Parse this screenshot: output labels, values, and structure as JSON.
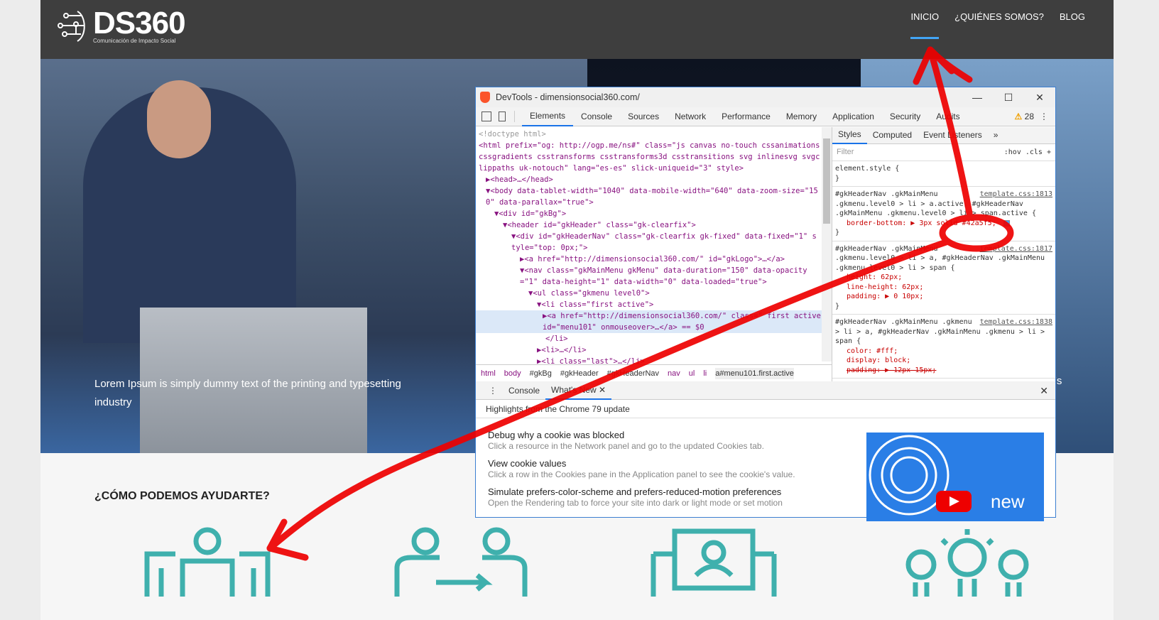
{
  "site": {
    "logo": {
      "title": "DS360",
      "subtitle": "Comunicación de Impacto Social"
    },
    "nav": [
      {
        "label": "INICIO",
        "active": true
      },
      {
        "label": "¿QUIÉNES SOMOS?"
      },
      {
        "label": "BLOG"
      }
    ],
    "accent": "#42a5f5",
    "hero_caption": "Lorem Ipsum is simply dummy text of the printing and typesetting industry",
    "hero_caption_right": "'s",
    "section_title": "¿CÓMO PODEMOS AYUDARTE?"
  },
  "devtools": {
    "title": "DevTools - dimensionsocial360.com/",
    "tabs": [
      "Elements",
      "Console",
      "Sources",
      "Network",
      "Performance",
      "Memory",
      "Application",
      "Security",
      "Audits"
    ],
    "warnings": "28",
    "elements": [
      "<!doctype html>",
      "<html prefix=\"og: http://ogp.me/ns#\" class=\"js canvas no-touch cssanimations cssgradients csstransforms csstransforms3d csstransitions svg inlinesvg svgclippaths uk-notouch\" lang=\"es-es\" slick-uniqueid=\"3\" style>",
      "▶<head>…</head>",
      "▼<body data-tablet-width=\"1040\" data-mobile-width=\"640\" data-zoom-size=\"150\" data-parallax=\"true\">",
      "▼<div id=\"gkBg\">",
      "▼<header id=\"gkHeader\" class=\"gk-clearfix\">",
      "▼<div id=\"gkHeaderNav\" class=\"gk-clearfix gk-fixed\" data-fixed=\"1\" style=\"top: 0px;\">",
      "▶<a href=\"http://dimensionsocial360.com/\" id=\"gkLogo\">…</a>",
      "▼<nav class=\"gkMainMenu gkMenu\" data-duration=\"150\" data-opacity=\"1\" data-height=\"1\" data-width=\"0\" data-loaded=\"true\">",
      "▼<ul class=\"gkmenu level0\">",
      "▼<li class=\"first active\">",
      "▶<a href=\"http://dimensionsocial360.com/\" class=\" first active\" id=\"menu101\" onmouseover>…</a> == $0",
      "</li>",
      "▶<li>…</li>",
      "▶<li class=\"last\">…</li>"
    ],
    "breadcrumbs": [
      "html",
      "body",
      "#gkBg",
      "#gkHeader",
      "#gkHeaderNav",
      "nav",
      "ul",
      "li",
      "a#menu101.first.active"
    ],
    "styles_tabs": [
      "Styles",
      "Computed",
      "Event Listeners",
      "»"
    ],
    "filter_placeholder": "Filter",
    "filter_tools": ":hov .cls +",
    "rules": [
      {
        "selector": "element.style {",
        "props": [],
        "source": ""
      },
      {
        "selector": "#gkHeaderNav .gkMainMenu .gkmenu.level0 > li > a.active, #gkHeaderNav .gkMainMenu .gkmenu.level0 > li > span.active {",
        "props": [
          "border-bottom: ▶ 3px solid #42a5f5;"
        ],
        "source": "template.css:1813"
      },
      {
        "selector": "#gkHeaderNav .gkMainMenu .gkmenu.level0 > li > a, #gkHeaderNav .gkMainMenu .gkmenu.level0 > li > span {",
        "props": [
          "height: 62px;",
          "line-height: 62px;",
          "padding: ▶ 0 10px;"
        ],
        "source": "template.css:1817"
      },
      {
        "selector": "#gkHeaderNav .gkMainMenu .gkmenu > li > a, #gkHeaderNav .gkMainMenu .gkmenu > li > span {",
        "props": [
          "color: #fff;",
          "display: block;",
          "padding: ▶ 12px 15px;"
        ],
        "source": "template.css:1838"
      }
    ],
    "drawer": {
      "tabs": [
        "Console",
        "What's New"
      ],
      "highlight": "Highlights from the Chrome 79 update",
      "features": [
        {
          "title": "Debug why a cookie was blocked",
          "desc": "Click a resource in the Network panel and go to the updated Cookies tab."
        },
        {
          "title": "View cookie values",
          "desc": "Click a row in the Cookies pane in the Application panel to see the cookie's value."
        },
        {
          "title": "Simulate prefers-color-scheme and prefers-reduced-motion preferences",
          "desc": "Open the Rendering tab to force your site into dark or light mode or set motion"
        }
      ],
      "video_label": "new"
    }
  }
}
